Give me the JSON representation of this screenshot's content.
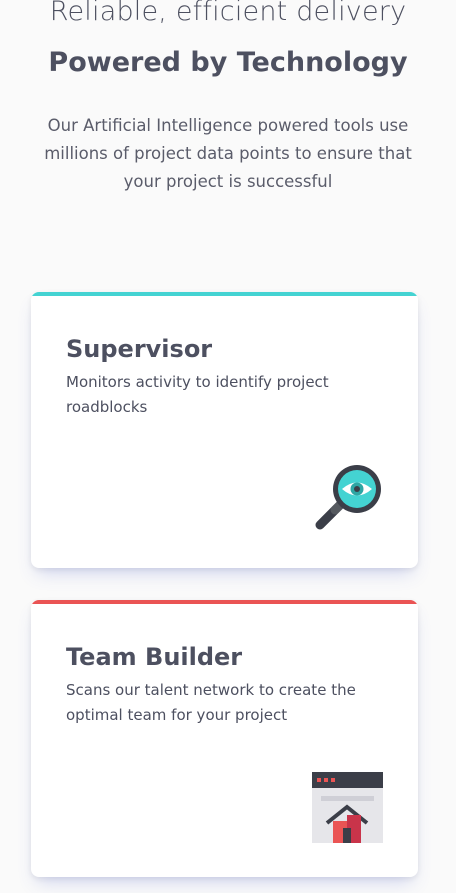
{
  "hero": {
    "subtitle": "Reliable, efficient delivery",
    "title": "Powered by Technology",
    "description": "Our Artificial Intelligence powered tools use millions of project data points to ensure that your project is successful"
  },
  "cards": [
    {
      "title": "Supervisor",
      "text": "Monitors activity to identify project roadblocks",
      "accent": "#44d3d2",
      "icon": "magnifier-eye-icon"
    },
    {
      "title": "Team Builder",
      "text": "Scans our talent network to create the optimal team for your project",
      "accent": "#ea5454",
      "icon": "team-builder-icon"
    }
  ],
  "colors": {
    "background": "#fafafa",
    "text": "#4d5060",
    "cyan": "#44d3d2",
    "red": "#ea5454"
  }
}
